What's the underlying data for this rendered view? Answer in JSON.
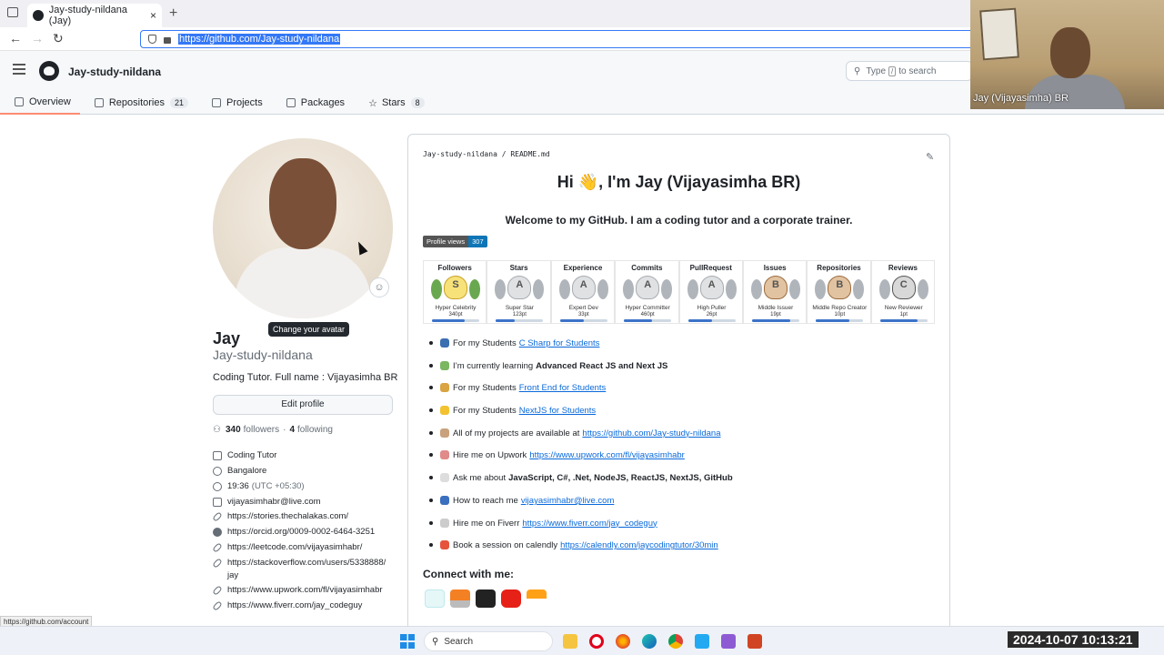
{
  "browser": {
    "tab_title": "Jay-study-nildana (Jay)",
    "new_tab": "+",
    "close": "×",
    "url": "https://github.com/Jay-study-nildana"
  },
  "github": {
    "username": "Jay-study-nildana",
    "search_placeholder_pre": "Type",
    "search_key": "/",
    "search_placeholder_post": "to search",
    "tabs": [
      {
        "label": "Overview"
      },
      {
        "label": "Repositories",
        "count": "21"
      },
      {
        "label": "Projects"
      },
      {
        "label": "Packages"
      },
      {
        "label": "Stars",
        "count": "8"
      }
    ]
  },
  "video": {
    "name": "Jay (Vijayasimha) BR"
  },
  "profile": {
    "tooltip": "Change your avatar",
    "name": "Jay",
    "login": "Jay-study-nildana",
    "bio": "Coding Tutor. Full name : Vijayasimha BR",
    "edit_button": "Edit profile",
    "followers_count": "340",
    "followers_label": "followers",
    "sep": "·",
    "following_count": "4",
    "following_label": "following",
    "company": "Coding Tutor",
    "location": "Bangalore",
    "time": "19:36",
    "timezone": "(UTC +05:30)",
    "email": "vijayasimhabr@live.com",
    "links": [
      "https://stories.thechalakas.com/",
      "https://orcid.org/0009-0002-6464-3251",
      "https://leetcode.com/vijayasimhabr/",
      "https://stackoverflow.com/users/5338888/",
      "jay",
      "https://www.upwork.com/fl/vijayasimhabr",
      "https://www.fiverr.com/jay_codeguy"
    ]
  },
  "status_link": "https://github.com/account",
  "readme": {
    "path": "Jay-study-nildana / README.md",
    "heading": "Hi 👋, I'm Jay (Vijayasimha BR)",
    "welcome": "Welcome to my GitHub. I am a coding tutor and a corporate trainer.",
    "views_label": "Profile views",
    "views_count": "307",
    "trophies": [
      {
        "title": "Followers",
        "rank": "S",
        "sub": "Hyper Celebrity",
        "pt": "340pt",
        "progress": 0.7
      },
      {
        "title": "Stars",
        "rank": "A",
        "sub": "Super Star",
        "pt": "123pt",
        "progress": 0.4
      },
      {
        "title": "Experience",
        "rank": "A",
        "sub": "Expert Dev",
        "pt": "33pt",
        "progress": 0.5
      },
      {
        "title": "Commits",
        "rank": "A",
        "sub": "Hyper Committer",
        "pt": "460pt",
        "progress": 0.6
      },
      {
        "title": "PullRequest",
        "rank": "A",
        "sub": "High Puller",
        "pt": "26pt",
        "progress": 0.5
      },
      {
        "title": "Issues",
        "rank": "B",
        "sub": "Middle Issuer",
        "pt": "19pt",
        "progress": 0.8
      },
      {
        "title": "Repositories",
        "rank": "B",
        "sub": "Middle Repo Creator",
        "pt": "10pt",
        "progress": 0.7
      },
      {
        "title": "Reviews",
        "rank": "C",
        "sub": "New Reviewer",
        "pt": "1pt",
        "progress": 0.8
      }
    ],
    "bullets": [
      {
        "text": "For my Students",
        "link": "C Sharp for Students",
        "color": "#3a6fb0"
      },
      {
        "text": "I’m currently learning",
        "bold": "Advanced React JS and Next JS",
        "color": "#7bb661"
      },
      {
        "text": "For my Students",
        "link": "Front End for Students",
        "color": "#d9a441"
      },
      {
        "text": "For my Students",
        "link": "NextJS for Students",
        "color": "#f2c230"
      },
      {
        "text": "All of my projects are available at",
        "link": "https://github.com/Jay-study-nildana",
        "color": "#c8a27c"
      },
      {
        "text": "Hire me on Upwork",
        "link": "https://www.upwork.com/fl/vijayasimhabr",
        "color": "#e08a8a"
      },
      {
        "text": "Ask me about",
        "bold": "JavaScript, C#, .Net, NodeJS, ReactJS, NextJS, GitHub",
        "color": "#dddddd"
      },
      {
        "text": "How to reach me",
        "link": "vijayasimhabr@live.com",
        "color": "#3b6fbf"
      },
      {
        "text": "Hire me on Fiverr",
        "link": "https://www.fiverr.com/jay_codeguy",
        "color": "#cccccc"
      },
      {
        "text": "Book a session on calendly",
        "link": "https://calendly.com/jaycodingtutor/30min",
        "color": "#e5533d"
      }
    ],
    "connect": "Connect with me:"
  },
  "taskbar": {
    "search": "Search"
  },
  "clock": "2024-10-07  10:13:21"
}
